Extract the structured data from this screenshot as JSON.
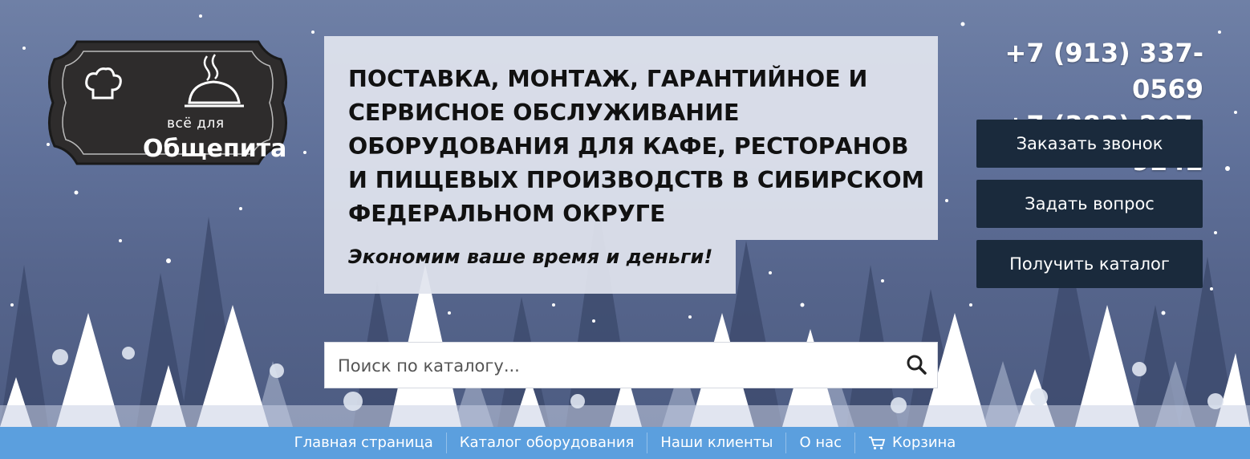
{
  "logo": {
    "line1": "всё для",
    "line2": "Общепита",
    "icons": [
      "chef-hat-icon",
      "cloche-icon"
    ]
  },
  "headline": {
    "title": "ПОСТАВКА, МОНТАЖ, ГАРАНТИЙНОЕ И СЕРВИСНОЕ ОБСЛУЖИВАНИЕ ОБОРУДОВАНИЯ ДЛЯ КАФЕ, РЕСТОРАНОВ И ПИЩЕВЫХ ПРОИЗВОДСТВ В СИБИРСКОМ ФЕДЕРАЛЬНОМ ОКРУГЕ",
    "slogan": "Экономим ваше время и деньги!"
  },
  "contacts": {
    "phone1": "+7 (913) 337-0569",
    "phone2": "+7 (383) 207-9242"
  },
  "actions": {
    "call": "Заказать звонок",
    "ask": "Задать вопрос",
    "catalog": "Получить каталог"
  },
  "search": {
    "placeholder": "Поиск по каталогу...",
    "icon": "search-icon"
  },
  "nav": {
    "home": "Главная страница",
    "catalog": "Каталог оборудования",
    "clients": "Наши клиенты",
    "about": "О нас",
    "cart": "Корзина",
    "cart_icon": "cart-icon"
  },
  "colors": {
    "nav_bg": "#5b9fde",
    "button_bg": "#1a2a3c",
    "headline_bg": "#e1e4ee"
  }
}
